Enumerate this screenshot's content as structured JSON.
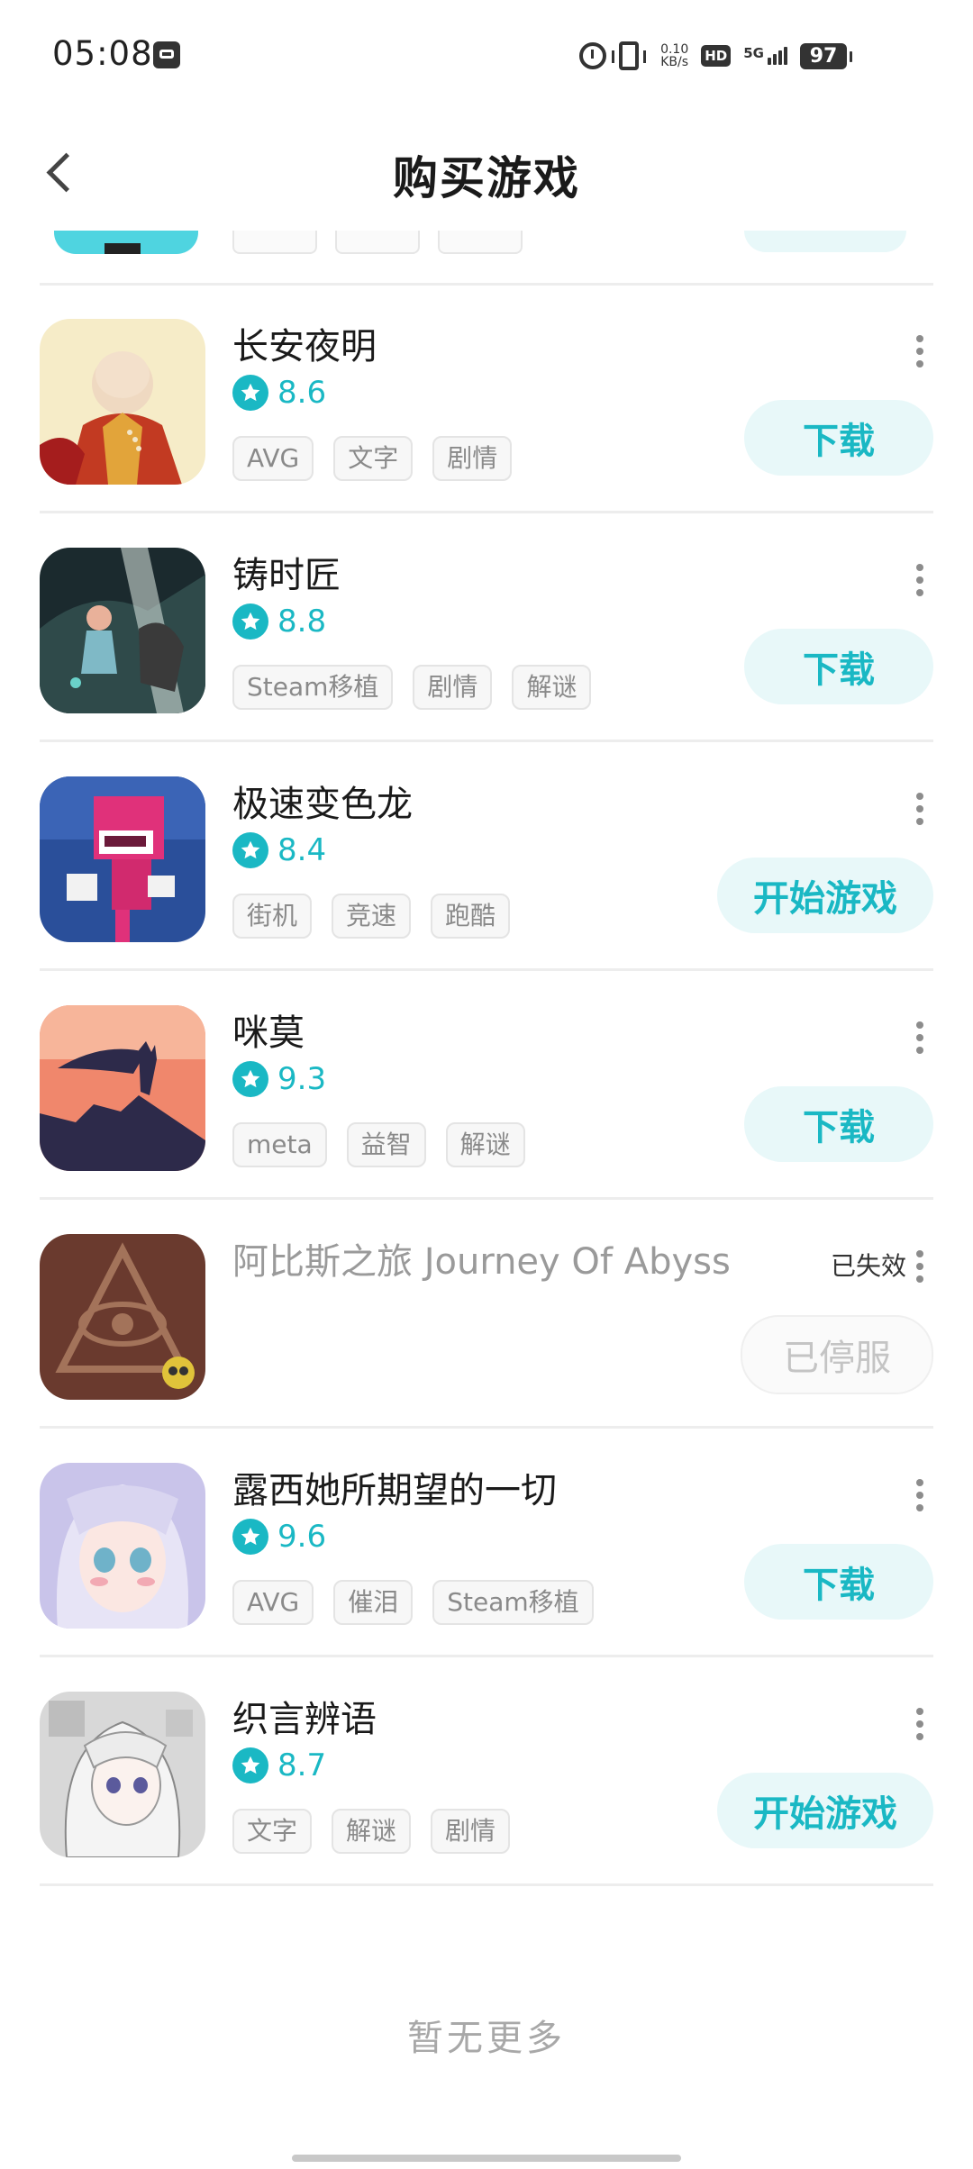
{
  "status_bar": {
    "time": "05:08",
    "net_speed_value": "0.10",
    "net_speed_unit": "KB/s",
    "hd": "HD",
    "network": "5G",
    "battery": "97"
  },
  "header": {
    "title": "购买游戏"
  },
  "games": [
    {
      "name": "长安夜明",
      "rating": "8.6",
      "tags": [
        "AVG",
        "文字",
        "剧情"
      ],
      "action": "下载",
      "status": "active"
    },
    {
      "name": "铸时匠",
      "rating": "8.8",
      "tags": [
        "Steam移植",
        "剧情",
        "解谜"
      ],
      "action": "下载",
      "status": "active"
    },
    {
      "name": "极速变色龙",
      "rating": "8.4",
      "tags": [
        "街机",
        "竞速",
        "跑酷"
      ],
      "action": "开始游戏",
      "status": "active"
    },
    {
      "name": "咪莫",
      "rating": "9.3",
      "tags": [
        "meta",
        "益智",
        "解谜"
      ],
      "action": "下载",
      "status": "active"
    },
    {
      "name": "阿比斯之旅 Journey Of Abyss",
      "expired_label": "已失效",
      "action": "已停服",
      "status": "expired"
    },
    {
      "name": "露西她所期望的一切",
      "rating": "9.6",
      "tags": [
        "AVG",
        "催泪",
        "Steam移植"
      ],
      "action": "下载",
      "status": "active"
    },
    {
      "name": "织言辨语",
      "rating": "8.7",
      "tags": [
        "文字",
        "解谜",
        "剧情"
      ],
      "action": "开始游戏",
      "status": "active"
    }
  ],
  "footer": {
    "no_more": "暂无更多"
  },
  "colors": {
    "accent": "#1ab8c4",
    "button_bg": "#e8f8f9",
    "divider": "#ededed"
  }
}
